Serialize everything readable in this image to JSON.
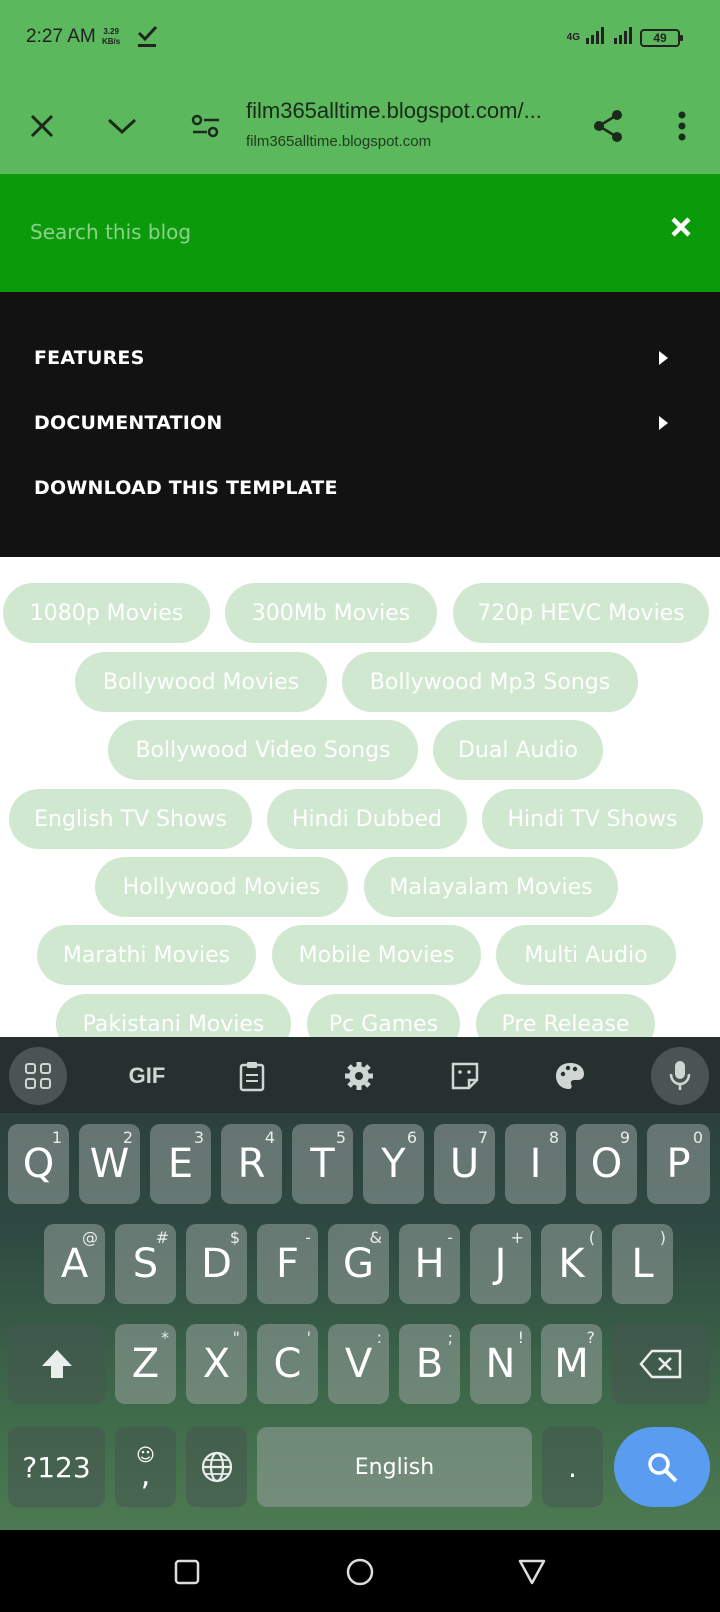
{
  "status_bar": {
    "time": "2:27 AM",
    "speed_value": "3.29",
    "speed_unit": "KB/s",
    "network": "4G",
    "battery": "49"
  },
  "browser": {
    "url_title": "film365alltime.blogspot.com/...",
    "url_domain": "film365alltime.blogspot.com",
    "icons": [
      "close-icon",
      "chevron-down-icon",
      "page-settings-icon",
      "share-icon",
      "more-vert-icon"
    ]
  },
  "search": {
    "placeholder": "Search this blog"
  },
  "menu": {
    "items": [
      {
        "label": "FEATURES",
        "has_submenu": true
      },
      {
        "label": "DOCUMENTATION",
        "has_submenu": true
      },
      {
        "label": "DOWNLOAD THIS TEMPLATE",
        "has_submenu": false
      }
    ]
  },
  "tags": [
    "1080p Movies",
    "300Mb Movies",
    "720p HEVC Movies",
    "Bollywood Movies",
    "Bollywood Mp3 Songs",
    "Bollywood Video Songs",
    "Dual Audio",
    "English TV Shows",
    "Hindi Dubbed",
    "Hindi TV Shows",
    "Hollywood Movies",
    "Malayalam Movies",
    "Marathi Movies",
    "Mobile Movies",
    "Multi Audio",
    "Pakistani Movies",
    "Pc Games",
    "Pre Release"
  ],
  "keyboard": {
    "toolbar": {
      "gif_label": "GIF"
    },
    "row1": [
      {
        "k": "Q",
        "s": "1"
      },
      {
        "k": "W",
        "s": "2"
      },
      {
        "k": "E",
        "s": "3"
      },
      {
        "k": "R",
        "s": "4"
      },
      {
        "k": "T",
        "s": "5"
      },
      {
        "k": "Y",
        "s": "6"
      },
      {
        "k": "U",
        "s": "7"
      },
      {
        "k": "I",
        "s": "8"
      },
      {
        "k": "O",
        "s": "9"
      },
      {
        "k": "P",
        "s": "0"
      }
    ],
    "row2": [
      {
        "k": "A",
        "s": "@"
      },
      {
        "k": "S",
        "s": "#"
      },
      {
        "k": "D",
        "s": "$"
      },
      {
        "k": "F",
        "s": "-"
      },
      {
        "k": "G",
        "s": "&"
      },
      {
        "k": "H",
        "s": "-"
      },
      {
        "k": "J",
        "s": "+"
      },
      {
        "k": "K",
        "s": "("
      },
      {
        "k": "L",
        "s": ")"
      }
    ],
    "row3": [
      {
        "k": "Z",
        "s": "*"
      },
      {
        "k": "X",
        "s": "\""
      },
      {
        "k": "C",
        "s": "'"
      },
      {
        "k": "V",
        "s": ":"
      },
      {
        "k": "B",
        "s": ";"
      },
      {
        "k": "N",
        "s": "!"
      },
      {
        "k": "M",
        "s": "?"
      }
    ],
    "symbols_label": "?123",
    "comma_label": ",",
    "space_label": "English",
    "period_label": "."
  },
  "colors": {
    "toolbar_green": "#5cb85c",
    "search_green": "#0a9a0a",
    "menu_dark": "#121212",
    "tag_bg": "#cfe8cf",
    "key_accent": "#5a9df0"
  }
}
